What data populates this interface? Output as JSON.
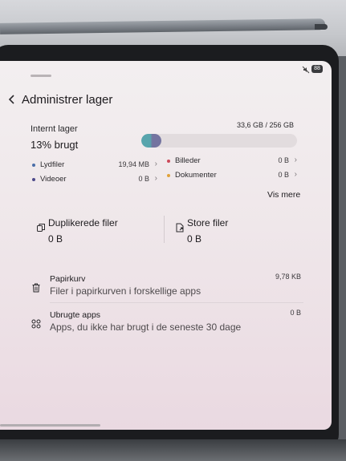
{
  "status_bar": {
    "battery": "88",
    "icons": [
      "mute-icon",
      "battery-icon"
    ]
  },
  "header": {
    "title": "Administrer lager",
    "back_icon": "chevron-left-icon"
  },
  "storage": {
    "label": "Internt lager",
    "capacity": "33,6 GB / 256 GB",
    "percent_text": "13% brugt",
    "used_fraction": 0.13,
    "categories": [
      {
        "name": "Lydfiler",
        "size": "19,94 MB",
        "color": "#4a6ea8"
      },
      {
        "name": "Videoer",
        "size": "0 B",
        "color": "#4d4a8a"
      },
      {
        "name": "Billeder",
        "size": "0 B",
        "color": "#cc4a5a"
      },
      {
        "name": "Dokumenter",
        "size": "0 B",
        "color": "#e0a23a"
      }
    ],
    "view_more": "Vis mere"
  },
  "cards": [
    {
      "label": "Duplikerede filer",
      "value": "0 B",
      "icon": "duplicate-files-icon"
    },
    {
      "label": "Store filer",
      "value": "0 B",
      "icon": "large-file-icon"
    }
  ],
  "list": [
    {
      "title": "Papirkurv",
      "subtitle": "Filer i papirkurven i forskellige apps",
      "size": "9,78 KB",
      "icon": "trash-icon"
    },
    {
      "title": "Ubrugte apps",
      "subtitle": "Apps, du ikke har brugt i de seneste 30 dage",
      "size": "0 B",
      "icon": "apps-grid-icon"
    }
  ],
  "colors": {
    "accent_teal": "#58a5ad",
    "accent_purple": "#7474a0",
    "background": "#f1ecee"
  }
}
